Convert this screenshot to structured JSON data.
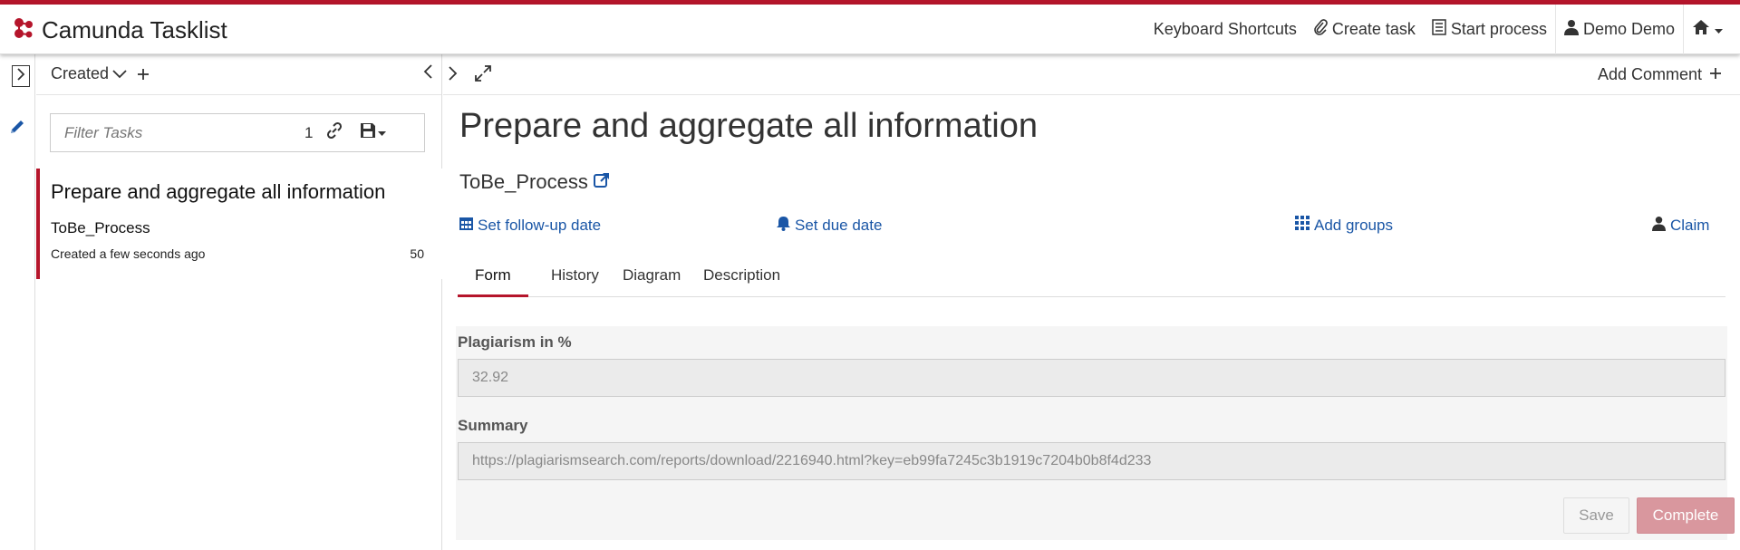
{
  "app": {
    "title": "Camunda Tasklist",
    "accent_color": "#b5152b",
    "link_color": "#1a56a6"
  },
  "header": {
    "items": [
      {
        "label": "Keyboard Shortcuts",
        "icon": ""
      },
      {
        "label": "Create task",
        "icon": "paperclip-icon"
      },
      {
        "label": "Start process",
        "icon": "list-icon"
      },
      {
        "label": "Demo Demo",
        "icon": "user-icon"
      }
    ],
    "home_icon": "home-icon"
  },
  "list": {
    "sort_label": "Created",
    "filter_placeholder": "Filter Tasks",
    "filter_count": "1",
    "tasks": [
      {
        "name": "Prepare and aggregate all information",
        "process": "ToBe_Process",
        "created": "Created a few seconds ago",
        "priority": "50"
      }
    ]
  },
  "detail": {
    "add_comment": "Add Comment",
    "task_name": "Prepare and aggregate all information",
    "process_name": "ToBe_Process",
    "actions": {
      "follow_up": "Set follow-up date",
      "due_date": "Set due date",
      "groups": "Add groups",
      "claim": "Claim"
    },
    "tabs": [
      "Form",
      "History",
      "Diagram",
      "Description"
    ],
    "active_tab": "Form",
    "form": {
      "fields": [
        {
          "label": "Plagiarism in %",
          "value": "32.92"
        },
        {
          "label": "Summary",
          "value": "https://plagiarismsearch.com/reports/download/2216940.html?key=eb99fa7245c3b1919c7204b0b8f4d233"
        }
      ],
      "save_label": "Save",
      "complete_label": "Complete"
    }
  }
}
